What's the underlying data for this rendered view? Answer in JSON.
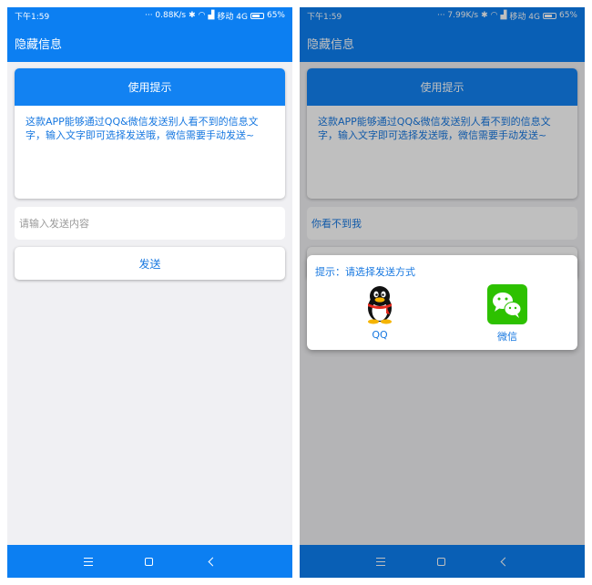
{
  "colors": {
    "primary": "#0c7ff2",
    "text_blue": "#1677e0",
    "background": "#f0f0f3",
    "wechat_green": "#2dc100"
  },
  "left": {
    "status": {
      "time": "下午1:59",
      "speed": "··· 0.88K/s",
      "carrier": "移动 4G",
      "battery": "65%"
    },
    "app_title": "隐藏信息",
    "tip_title": "使用提示",
    "tip_body": "这款APP能够通过QQ&微信发送别人看不到的信息文字，输入文字即可选择发送哦，微信需要手动发送~",
    "input": {
      "value": "",
      "placeholder": "请输入发送内容"
    },
    "send_label": "发送"
  },
  "right": {
    "status": {
      "time": "下午1:59",
      "speed": "··· 7.99K/s",
      "carrier": "移动 4G",
      "battery": "65%"
    },
    "app_title": "隐藏信息",
    "tip_title": "使用提示",
    "tip_body": "这款APP能够通过QQ&微信发送别人看不到的信息文字，输入文字即可选择发送哦，微信需要手动发送~",
    "input": {
      "value": "你看不到我"
    },
    "dialog": {
      "title": "提示：请选择发送方式",
      "options": [
        {
          "icon": "qq-penguin-icon",
          "label": "QQ"
        },
        {
          "icon": "wechat-icon",
          "label": "微信"
        }
      ]
    }
  },
  "navbar": {
    "icons": [
      "menu-icon",
      "home-icon",
      "back-icon"
    ]
  }
}
